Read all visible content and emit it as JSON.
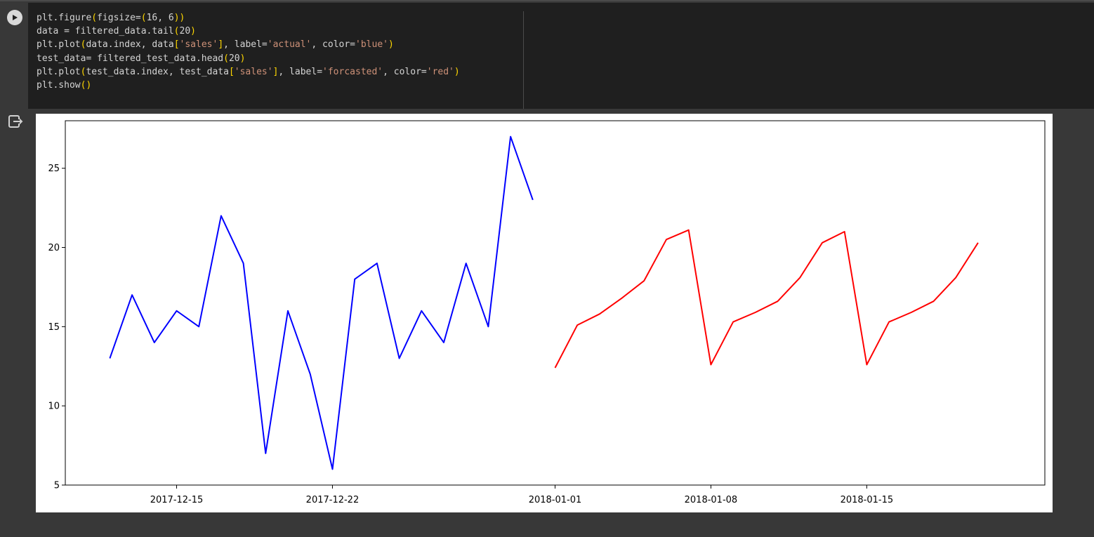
{
  "cell": {
    "run_button_icon": "play-icon",
    "output_icon": "output-arrow-icon"
  },
  "code_lines": [
    [
      {
        "t": "plt.figure"
      },
      {
        "t": "(",
        "c": "br"
      },
      {
        "t": "figsize=",
        "c": ""
      },
      {
        "t": "(",
        "c": "br"
      },
      {
        "t": "16",
        "c": ""
      },
      {
        "t": ", ",
        "c": ""
      },
      {
        "t": "6",
        "c": ""
      },
      {
        "t": ")",
        "c": "br"
      },
      {
        "t": ")",
        "c": "br"
      }
    ],
    [
      {
        "t": "data = filtered_data.tail"
      },
      {
        "t": "(",
        "c": "br"
      },
      {
        "t": "20"
      },
      {
        "t": ")",
        "c": "br"
      }
    ],
    [
      {
        "t": "plt.plot"
      },
      {
        "t": "(",
        "c": "br"
      },
      {
        "t": "data.index, data"
      },
      {
        "t": "[",
        "c": "br"
      },
      {
        "t": "'sales'",
        "c": "str"
      },
      {
        "t": "]",
        "c": "br"
      },
      {
        "t": ", label="
      },
      {
        "t": "'actual'",
        "c": "str"
      },
      {
        "t": ", color="
      },
      {
        "t": "'blue'",
        "c": "str"
      },
      {
        "t": ")",
        "c": "br"
      }
    ],
    [
      {
        "t": "test_data= filtered_test_data.head"
      },
      {
        "t": "(",
        "c": "br"
      },
      {
        "t": "20"
      },
      {
        "t": ")",
        "c": "br"
      }
    ],
    [
      {
        "t": "plt.plot"
      },
      {
        "t": "(",
        "c": "br"
      },
      {
        "t": "test_data.index, test_data"
      },
      {
        "t": "[",
        "c": "br"
      },
      {
        "t": "'sales'",
        "c": "str"
      },
      {
        "t": "]",
        "c": "br"
      },
      {
        "t": ", label="
      },
      {
        "t": "'forcasted'",
        "c": "str"
      },
      {
        "t": ", color="
      },
      {
        "t": "'red'",
        "c": "str"
      },
      {
        "t": ")",
        "c": "br"
      }
    ],
    [
      {
        "t": "plt.show"
      },
      {
        "t": "(",
        "c": "br"
      },
      {
        "t": ")",
        "c": "br"
      }
    ]
  ],
  "chart_data": {
    "type": "line",
    "title": "",
    "xlabel": "",
    "ylabel": "",
    "ylim": [
      5,
      28
    ],
    "xlim": [
      "2017-12-10",
      "2018-01-23"
    ],
    "yticks": [
      5,
      10,
      15,
      20,
      25
    ],
    "xticks": [
      "2017-12-15",
      "2017-12-22",
      "2018-01-01",
      "2018-01-08",
      "2018-01-15"
    ],
    "grid": false,
    "legend": null,
    "series": [
      {
        "color": "#0000ff",
        "x": [
          "2017-12-12",
          "2017-12-13",
          "2017-12-14",
          "2017-12-15",
          "2017-12-16",
          "2017-12-17",
          "2017-12-18",
          "2017-12-19",
          "2017-12-20",
          "2017-12-21",
          "2017-12-22",
          "2017-12-23",
          "2017-12-24",
          "2017-12-25",
          "2017-12-26",
          "2017-12-27",
          "2017-12-28",
          "2017-12-29",
          "2017-12-30",
          "2017-12-31"
        ],
        "values": [
          13,
          17,
          14,
          16,
          15,
          22,
          19,
          7,
          16,
          12,
          6,
          18,
          19,
          13,
          16,
          14,
          19,
          15,
          27,
          23
        ]
      },
      {
        "color": "#ff0000",
        "x": [
          "2018-01-01",
          "2018-01-02",
          "2018-01-03",
          "2018-01-04",
          "2018-01-05",
          "2018-01-06",
          "2018-01-07",
          "2018-01-08",
          "2018-01-09",
          "2018-01-10",
          "2018-01-11",
          "2018-01-12",
          "2018-01-13",
          "2018-01-14",
          "2018-01-15",
          "2018-01-16",
          "2018-01-17",
          "2018-01-18",
          "2018-01-19",
          "2018-01-20"
        ],
        "values": [
          12.4,
          15.1,
          15.8,
          16.8,
          17.9,
          20.5,
          21.1,
          12.6,
          15.3,
          15.9,
          16.6,
          18.1,
          20.3,
          21.0,
          12.6,
          15.3,
          15.9,
          16.6,
          18.1,
          20.3
        ]
      }
    ]
  }
}
